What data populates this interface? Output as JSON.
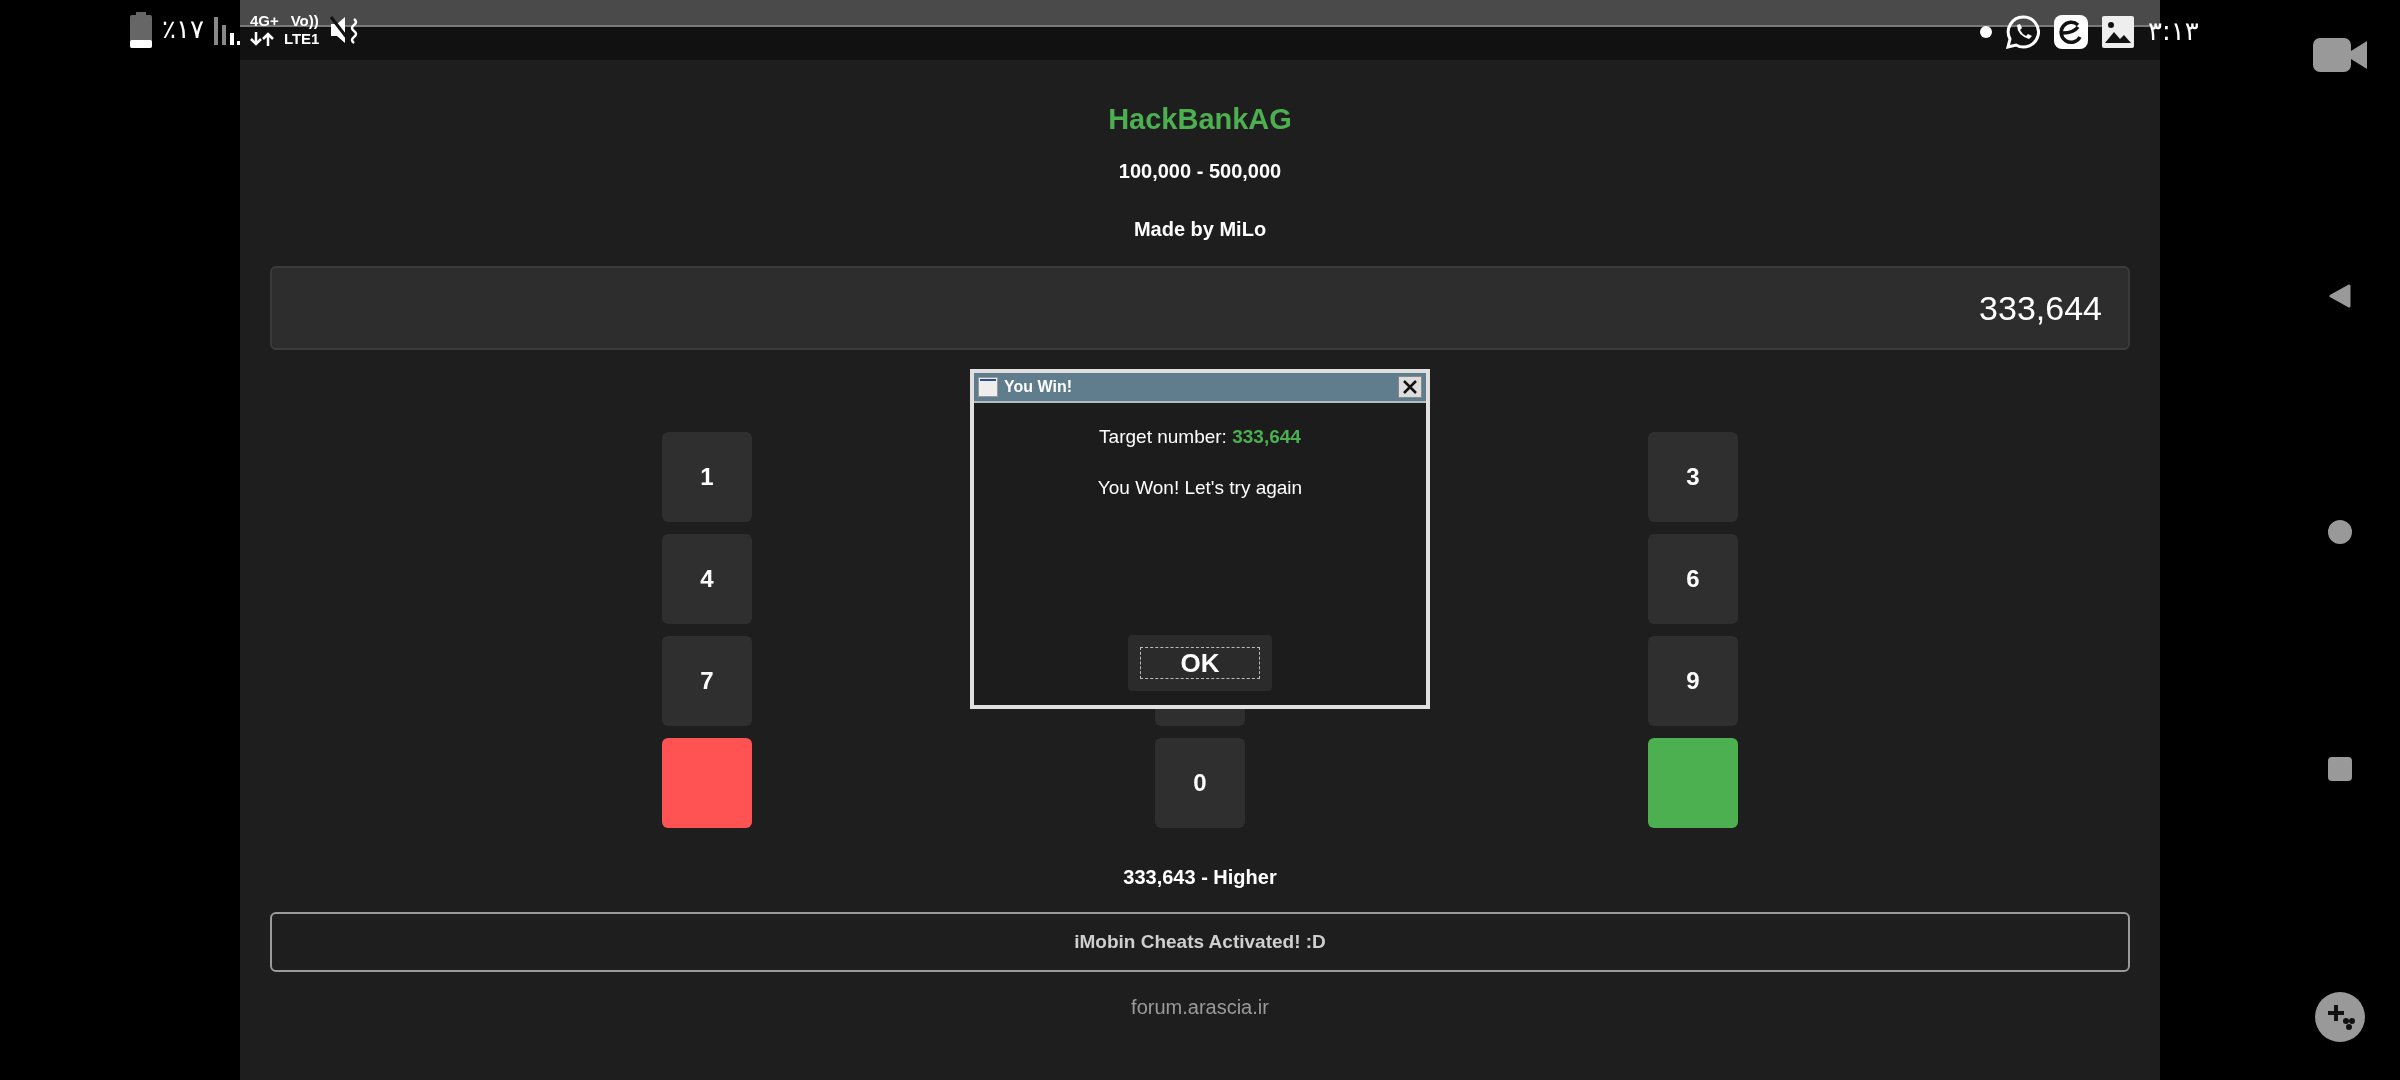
{
  "status_bar": {
    "battery": "٪١٧",
    "network_top": "4G+",
    "network_volte": "Vo))",
    "network_bottom": "LTE1",
    "time": "٣:١٣"
  },
  "app": {
    "title": "HackBankAG",
    "range": "100,000 - 500,000",
    "credit": "Made by MiLo",
    "display": "333,644",
    "keypad": [
      {
        "left": {
          "kind": "digit",
          "label": "1"
        },
        "right": {
          "kind": "digit",
          "label": "3"
        }
      },
      {
        "left": {
          "kind": "digit",
          "label": "4"
        },
        "right": {
          "kind": "digit",
          "label": "6"
        }
      },
      {
        "left": {
          "kind": "digit",
          "label": "7"
        },
        "middle": {
          "kind": "covered"
        },
        "right": {
          "kind": "digit",
          "label": "9"
        }
      },
      {
        "left": {
          "kind": "clear"
        },
        "middle": {
          "kind": "digit",
          "label": "0"
        },
        "right": {
          "kind": "enter"
        }
      }
    ],
    "hint": "333,643 - Higher",
    "banner": "iMobin Cheats Activated! :D",
    "footer": "forum.arascia.ir"
  },
  "dialog": {
    "title": "You Win!",
    "target_label": "Target number:",
    "target_value": "333,644",
    "message": "You Won! Let's try again",
    "button": "OK"
  }
}
